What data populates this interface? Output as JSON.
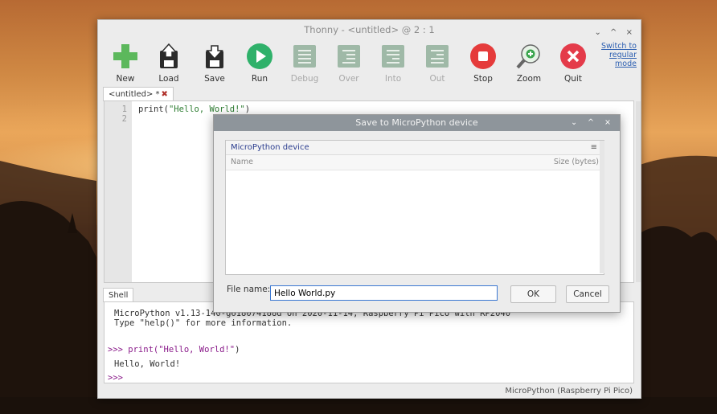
{
  "window": {
    "title": "Thonny - <untitled> @ 2 : 1",
    "controls": "⌄ ^ ×",
    "switch_mode": "Switch to regular mode"
  },
  "toolbar": {
    "new": "New",
    "load": "Load",
    "save": "Save",
    "run": "Run",
    "debug": "Debug",
    "over": "Over",
    "into": "Into",
    "out": "Out",
    "stop": "Stop",
    "zoom": "Zoom",
    "quit": "Quit"
  },
  "editor": {
    "tab_label": "<untitled> *",
    "tab_close": "✖",
    "line_numbers": [
      "1",
      "2"
    ],
    "code_fn": "print(",
    "code_str": "\"Hello, World!\"",
    "code_end": ")"
  },
  "shell": {
    "tab_label": "Shell",
    "banner_1": "MicroPython v1.13-140-g618074188d on 2020-11-14; Raspberry Pi Pico with RP2040",
    "banner_2": "Type \"help()\" for more information.",
    "prompt": ">>>",
    "cmd_fn": " print(",
    "cmd_str": "\"Hello, World!\"",
    "cmd_end": ")",
    "output": "Hello, World!",
    "prompt2": ">>>"
  },
  "status": "MicroPython (Raspberry Pi Pico)",
  "dialog": {
    "title": "Save to MicroPython device",
    "controls": "⌄ ^ ×",
    "panel_title": "MicroPython device",
    "menu_icon": "≡",
    "col_name": "Name",
    "col_size": "Size (bytes)",
    "file_name_label": "File name:",
    "file_name_value": "Hello World.py",
    "ok": "OK",
    "cancel": "Cancel"
  },
  "colors": {
    "new_green": "#5cb85c",
    "run_green": "#2fb16a",
    "stop_red": "#e53b3b",
    "quit_red": "#e43b4a",
    "link_blue": "#2a5db0"
  },
  "icons": [
    "plus-icon",
    "load-icon",
    "save-icon",
    "run-icon",
    "debug-icon",
    "over-icon",
    "into-icon",
    "out-icon",
    "stop-icon",
    "zoom-icon",
    "quit-icon"
  ]
}
